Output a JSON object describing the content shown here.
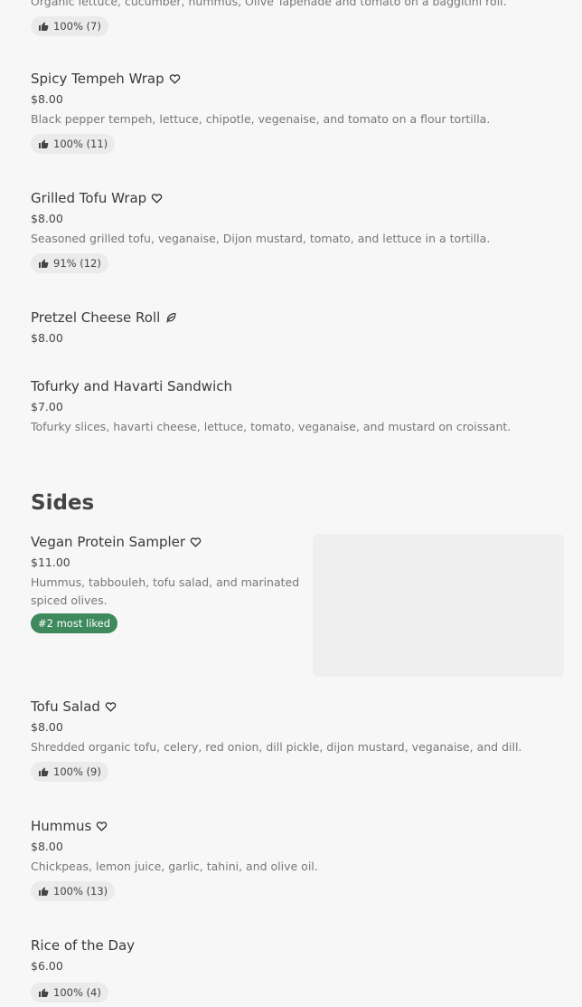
{
  "items": [
    {
      "desc": "Organic lettuce, cucumber, hummus, Olive Tapenade and tomato on a baggitini roll.",
      "rating": "100% (7)"
    },
    {
      "name": "Spicy Tempeh Wrap",
      "price": "$8.00",
      "desc": "Black pepper tempeh, lettuce, chipotle, vegenaise, and tomato on a flour tortilla.",
      "rating": "100% (11)"
    },
    {
      "name": "Grilled Tofu Wrap",
      "price": "$8.00",
      "desc": "Seasoned grilled tofu, veganaise, Dijon mustard, tomato, and lettuce in a tortilla.",
      "rating": "91% (12)"
    },
    {
      "name": "Pretzel Cheese Roll",
      "price": "$8.00"
    },
    {
      "name": "Tofurky and Havarti Sandwich",
      "price": "$7.00",
      "desc": "Tofurky slices, havarti cheese, lettuce, tomato, veganaise, and mustard on croissant."
    }
  ],
  "sides": {
    "title": "Sides",
    "items": [
      {
        "name": "Vegan Protein Sampler",
        "price": "$11.00",
        "desc": "Hummus, tabbouleh, tofu salad, and marinated spiced olives.",
        "badge": "#2 most liked"
      },
      {
        "name": "Tofu Salad",
        "price": "$8.00",
        "desc": "Shredded organic tofu, celery, red onion, dill pickle, dijon mustard, veganaise, and dill.",
        "rating": "100% (9)"
      },
      {
        "name": "Hummus",
        "price": "$8.00",
        "desc": "Chickpeas, lemon juice, garlic, tahini, and olive oil.",
        "rating": "100% (13)"
      },
      {
        "name": "Rice of the Day",
        "price": "$6.00",
        "rating": "100% (4)"
      }
    ]
  },
  "icons": {
    "dietary_heart": "vegan-heart-icon",
    "dietary_leaf": "vegetarian-leaf-icon",
    "thumbs_up": "thumbs-up-icon"
  },
  "colors": {
    "accent_green": "#3f8a5c",
    "badge_bg": "#ebebeb"
  }
}
